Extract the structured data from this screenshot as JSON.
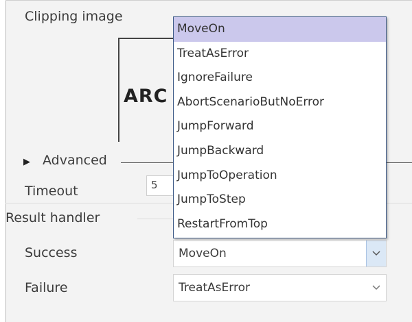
{
  "clipping": {
    "label": "Clipping image",
    "preview_text": "ARC"
  },
  "advanced": {
    "label": "Advanced",
    "expanded": false
  },
  "timeout": {
    "label": "Timeout",
    "value": "5"
  },
  "result_handler": {
    "section_label": "Result handler",
    "success": {
      "label": "Success",
      "value": "MoveOn"
    },
    "failure": {
      "label": "Failure",
      "value": "TreatAsError"
    }
  },
  "dropdown": {
    "selected_index": 0,
    "options": [
      "MoveOn",
      "TreatAsError",
      "IgnoreFailure",
      "AbortScenarioButNoError",
      "JumpForward",
      "JumpBackward",
      "JumpToOperation",
      "JumpToStep",
      "RestartFromTop"
    ]
  },
  "colors": {
    "selected_option_bg": "#cbc8ec",
    "dropdown_border": "#3d5a87",
    "panel_bg": "#f3f3f3"
  }
}
